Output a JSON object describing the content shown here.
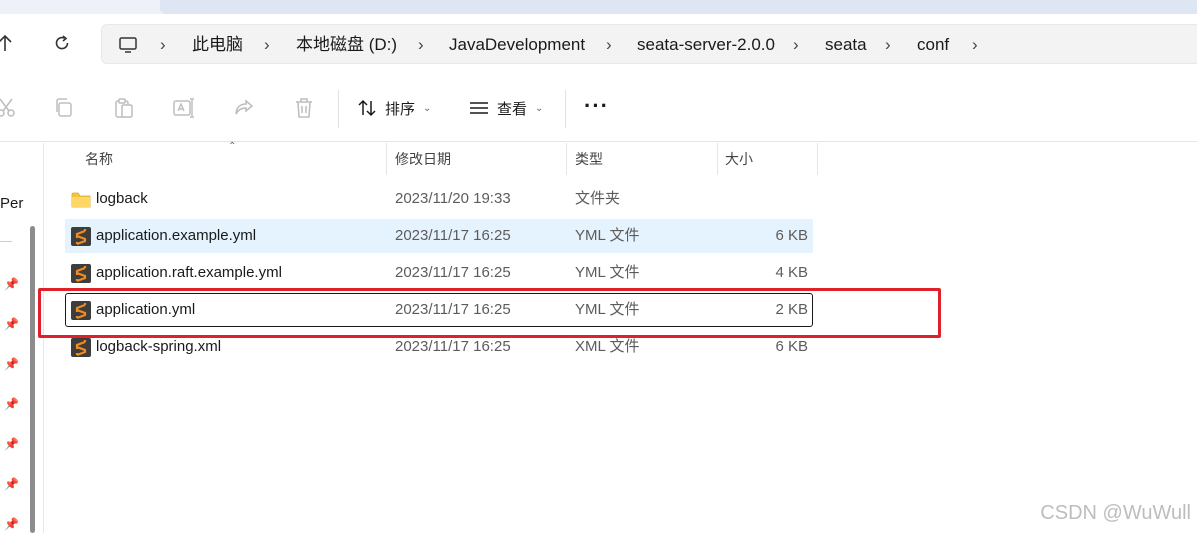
{
  "nav": {
    "up_icon": "arrow-up-icon",
    "refresh_icon": "refresh-icon",
    "pc_icon": "computer-icon",
    "breadcrumb": [
      "此电脑",
      "本地磁盘 (D:)",
      "JavaDevelopment",
      "seata-server-2.0.0",
      "seata",
      "conf"
    ]
  },
  "toolbar": {
    "icons": [
      "cut-icon",
      "copy-icon",
      "paste-icon",
      "rename-icon",
      "share-icon",
      "delete-icon"
    ],
    "sort_label": "排序",
    "view_label": "查看",
    "more_label": "···"
  },
  "leftpane": {
    "partial_label": "Per"
  },
  "columns": {
    "name": "名称",
    "date": "修改日期",
    "type": "类型",
    "size": "大小"
  },
  "files": [
    {
      "name": "logback",
      "date": "2023/11/20 19:33",
      "type": "文件夹",
      "size": "",
      "icon": "folder-icon"
    },
    {
      "name": "application.example.yml",
      "date": "2023/11/17 16:25",
      "type": "YML 文件",
      "size": "6 KB",
      "icon": "sublime-file-icon"
    },
    {
      "name": "application.raft.example.yml",
      "date": "2023/11/17 16:25",
      "type": "YML 文件",
      "size": "4 KB",
      "icon": "sublime-file-icon"
    },
    {
      "name": "application.yml",
      "date": "2023/11/17 16:25",
      "type": "YML 文件",
      "size": "2 KB",
      "icon": "sublime-file-icon"
    },
    {
      "name": "logback-spring.xml",
      "date": "2023/11/17 16:25",
      "type": "XML 文件",
      "size": "6 KB",
      "icon": "sublime-file-icon"
    }
  ],
  "colors": {
    "highlight_box": "#e0202a",
    "hover_row": "#e5f3ff",
    "sublime_orange": "#f28b1e"
  },
  "watermark": "CSDN @WuWull"
}
